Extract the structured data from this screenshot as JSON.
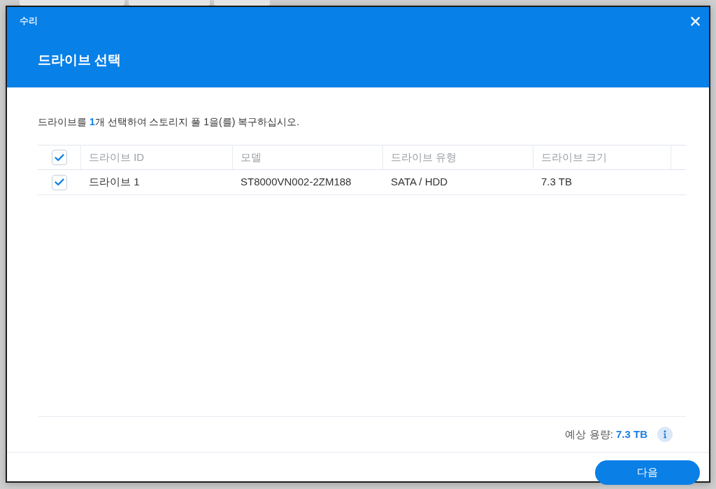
{
  "dialog": {
    "title": "수리",
    "heading": "드라이브 선택"
  },
  "instruction": {
    "before": "드라이브를 ",
    "count": "1",
    "after": "개 선택하여 스토리지 풀 1을(를) 복구하십시오."
  },
  "table": {
    "select_all_checked": true,
    "columns": [
      {
        "label": "드라이브 ID"
      },
      {
        "label": "모델"
      },
      {
        "label": "드라이브 유형"
      },
      {
        "label": "드라이브 크기"
      }
    ],
    "rows": [
      {
        "checked": true,
        "cells": [
          "드라이브 1",
          "ST8000VN002-2ZM188",
          "SATA / HDD",
          "7.3 TB"
        ]
      }
    ]
  },
  "summary": {
    "label": "예상 용량:",
    "value": "7.3 TB"
  },
  "buttons": [
    {
      "label": "다음",
      "kind": "primary"
    }
  ]
}
